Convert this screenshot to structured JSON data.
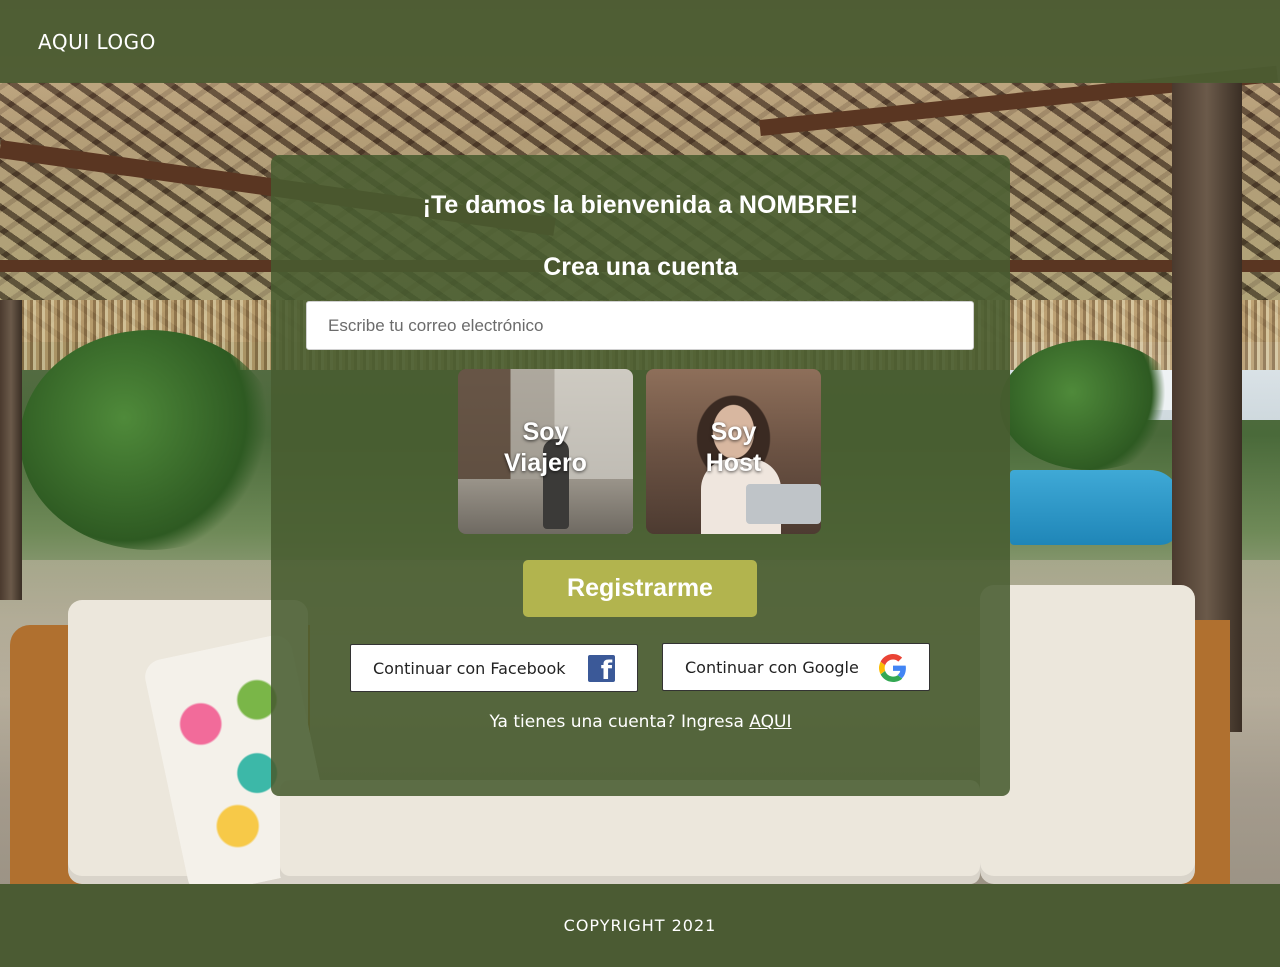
{
  "header": {
    "logo_text": "AQUI LOGO"
  },
  "signup": {
    "welcome_title": "¡Te damos la bienvenida a NOMBRE!",
    "subtitle": "Crea una cuenta",
    "email_placeholder": "Escribe tu correo electrónico",
    "roles": [
      {
        "line1": "Soy",
        "line2": "Viajero"
      },
      {
        "line1": "Soy",
        "line2": "Host"
      }
    ],
    "register_label": "Registrarme",
    "facebook_label": "Continuar con Facebook",
    "google_label": "Continuar con Google",
    "login_prompt": "Ya tienes una cuenta? Ingresa",
    "login_link": "AQUI"
  },
  "footer": {
    "copyright": "COPYRIGHT 2021"
  },
  "colors": {
    "header_bg": "#4b5c32",
    "card_bg": "#485c30",
    "register_button": "#b2b44e",
    "facebook_blue": "#3b5998"
  },
  "icons": [
    "facebook-icon",
    "google-icon"
  ]
}
